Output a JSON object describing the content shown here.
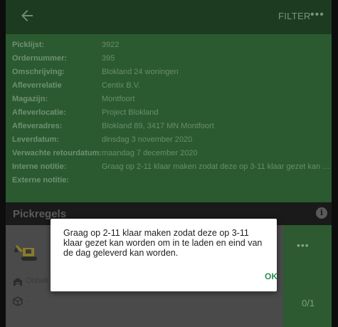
{
  "appbar": {
    "back_icon": "arrow-left-icon",
    "filter_label": "FILTER",
    "more_label": "•••"
  },
  "info": {
    "rows": [
      {
        "label": "Picklijst:",
        "value": "3922"
      },
      {
        "label": "Ordernummer:",
        "value": "395"
      },
      {
        "label": "Omschrijving:",
        "value": "Blokland 24 woningen"
      },
      {
        "label": "Afleverrelatie",
        "value": "Centix B.V."
      },
      {
        "label": "Magazijn:",
        "value": "Montfoort"
      },
      {
        "label": "Afleverlocatie:",
        "value": "Project Blokland"
      },
      {
        "label": "Afleveradres:",
        "value": "Blokland 89, 3417 MN Montfoort"
      },
      {
        "label": "Leverdatum:",
        "value": "dinsdag 3 november 2020"
      },
      {
        "label": "Verwachte retourdatum:",
        "value": "maandag 7 december 2020"
      },
      {
        "label": "Interne notitie:",
        "value": "Graag op 2-11 klaar maken zodat deze op 3-11 klaar gezet kan worde..."
      },
      {
        "label": "Externe notitie:",
        "value": ""
      }
    ]
  },
  "section": {
    "title": "Pickregels",
    "info_icon": "info-icon"
  },
  "card": {
    "more_label": "•••",
    "quantity": "0/1",
    "location_text": "Onbek",
    "cube_text": "-",
    "machine_icon": "excavator-icon"
  },
  "dialog": {
    "message": "Graag op 2-11 klaar maken zodat deze op 3-11 klaar gezet kan worden om in te laden en eind van de dag geleverd kan worden.",
    "ok_label": "OK"
  },
  "colors": {
    "appbar": "#1d3b20",
    "panel": "#2b5a30",
    "accent": "#2e8b57"
  }
}
